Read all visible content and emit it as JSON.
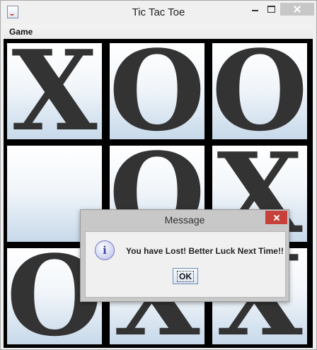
{
  "window": {
    "title": "Tic Tac Toe",
    "icon": "java-app-icon"
  },
  "menu": {
    "items": [
      {
        "label": "Game"
      }
    ]
  },
  "board": {
    "cells": [
      {
        "mark": "X"
      },
      {
        "mark": "O"
      },
      {
        "mark": "O"
      },
      {
        "mark": ""
      },
      {
        "mark": "O"
      },
      {
        "mark": "X"
      },
      {
        "mark": "O"
      },
      {
        "mark": "X"
      },
      {
        "mark": "X"
      }
    ],
    "mark_color": "#333333"
  },
  "dialog": {
    "title": "Message",
    "icon": "info-icon",
    "icon_glyph": "i",
    "message": "You have Lost! Better Luck Next Time!!",
    "ok_label": "OK",
    "close_color": "#c7403a"
  }
}
